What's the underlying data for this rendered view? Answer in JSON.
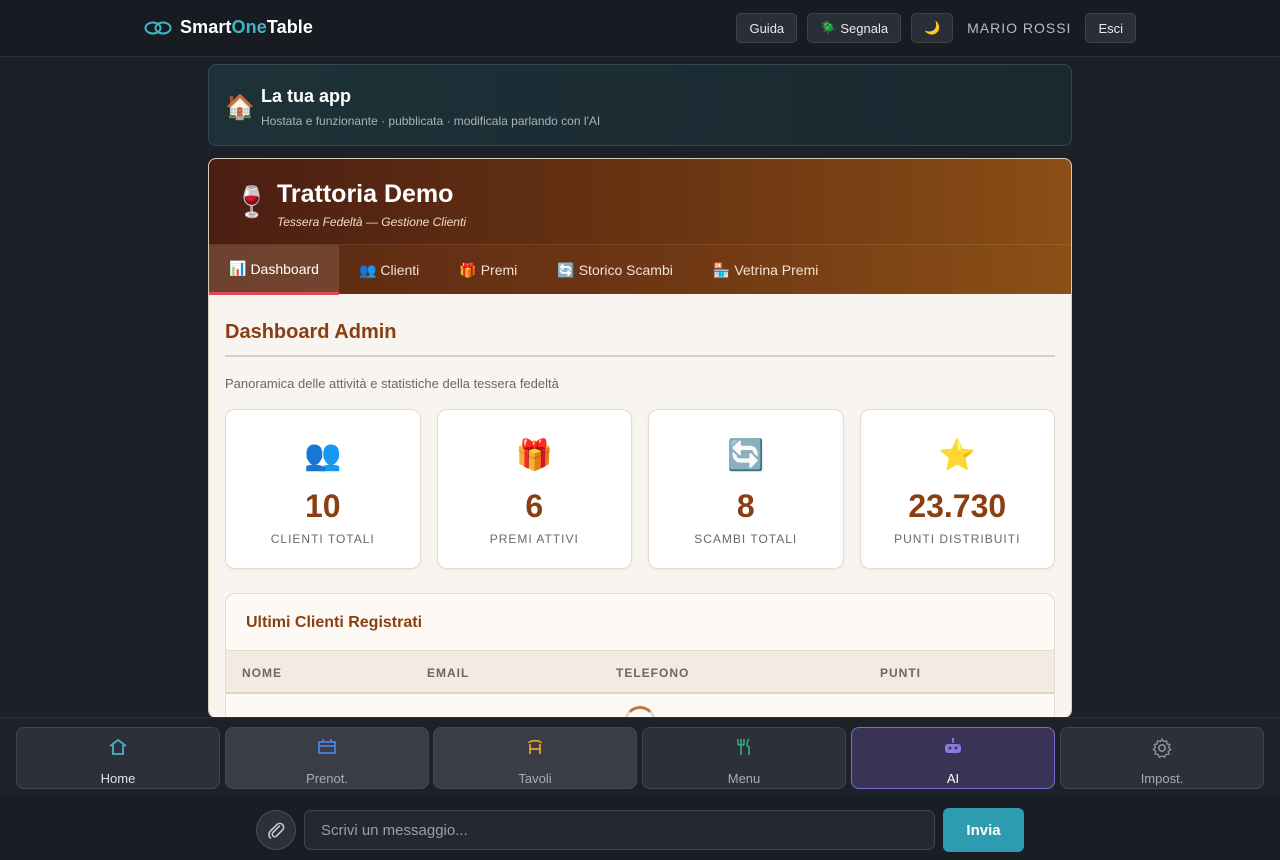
{
  "topbar": {
    "brand_prefix": "Smart",
    "brand_accent": "One",
    "brand_suffix": "Table",
    "guide_label": "Guida",
    "report_label": "Segnala",
    "report_icon": "🪲",
    "theme_icon": "🌙",
    "user_name": "MARIO ROSSI",
    "logout_label": "Esci"
  },
  "app_banner": {
    "icon": "🏠",
    "title": "La tua app",
    "subtitle": "Hostata e funzionante · pubblicata · modificala parlando con l'AI"
  },
  "card": {
    "icon": "🍷",
    "title": "Trattoria Demo",
    "subtitle": "Tessera Fedeltà — Gestione Clienti",
    "tabs": [
      {
        "icon": "📊",
        "label": "Dashboard"
      },
      {
        "icon": "👥",
        "label": "Clienti"
      },
      {
        "icon": "🎁",
        "label": "Premi"
      },
      {
        "icon": "🔄",
        "label": "Storico Scambi"
      },
      {
        "icon": "🏪",
        "label": "Vetrina Premi"
      }
    ]
  },
  "dashboard": {
    "title": "Dashboard Admin",
    "subtitle": "Panoramica delle attività e statistiche della tessera fedeltà",
    "stats": [
      {
        "icon": "👥",
        "value": "10",
        "label": "CLIENTI TOTALI"
      },
      {
        "icon": "🎁",
        "value": "6",
        "label": "PREMI ATTIVI"
      },
      {
        "icon": "🔄",
        "value": "8",
        "label": "SCAMBI TOTALI"
      },
      {
        "icon": "⭐",
        "value": "23.730",
        "label": "PUNTI DISTRIBUITI"
      }
    ],
    "recent": {
      "title": "Ultimi Clienti Registrati",
      "columns": [
        "NOME",
        "EMAIL",
        "TELEFONO",
        "PUNTI"
      ]
    }
  },
  "bottom_nav": [
    {
      "label": "Home"
    },
    {
      "label": "Prenot."
    },
    {
      "label": "Tavoli"
    },
    {
      "label": "Menu"
    },
    {
      "label": "AI"
    },
    {
      "label": "Impost."
    }
  ],
  "chat": {
    "placeholder": "Scrivi un messaggio...",
    "send_label": "Invia"
  },
  "colors": {
    "accent": "#3fb6c6",
    "brand_brown": "#8a3f12",
    "tab_active_underline": "#e14a55",
    "send_button": "#2d9bb0",
    "ai_active": "#7b6bd1"
  }
}
